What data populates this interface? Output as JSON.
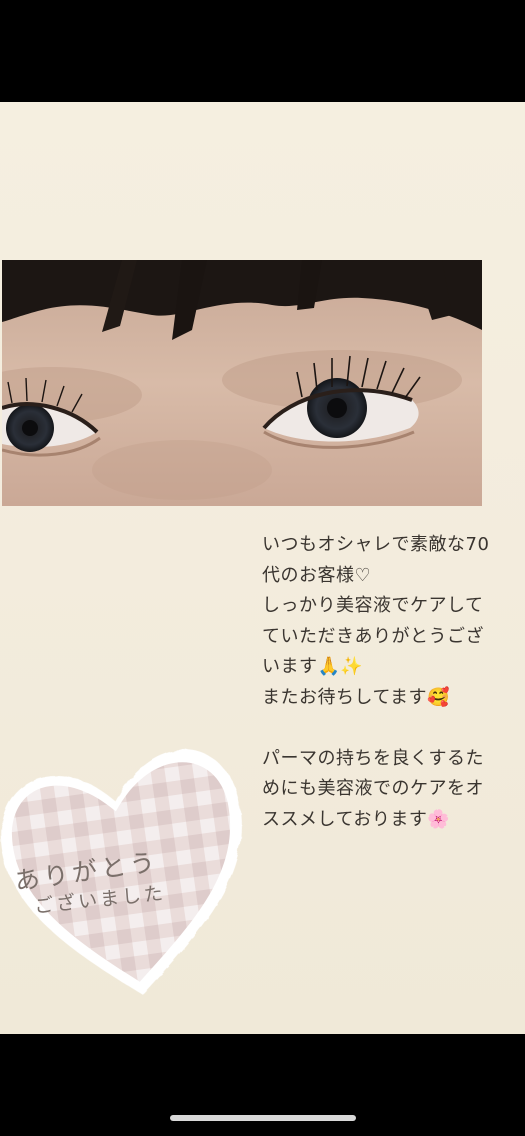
{
  "photo": {
    "description_icon": "eyelash-perm-photo"
  },
  "caption": {
    "line1": "いつもオシャレで素敵な70\n代のお客様♡\nしっかり美容液でケアして\nていただきありがとうござ\nいます🙏✨\nまたお待ちしてます🥰",
    "line2": "パーマの持ちを良くするた\nめにも美容液でのケアをオ\nススメしております🌸"
  },
  "sticker": {
    "line1": "ありがとう",
    "line2": "ございました"
  },
  "colors": {
    "background": "#f3ecdd",
    "text": "#3a3530",
    "heart_plaid": "#e8d8d6"
  }
}
